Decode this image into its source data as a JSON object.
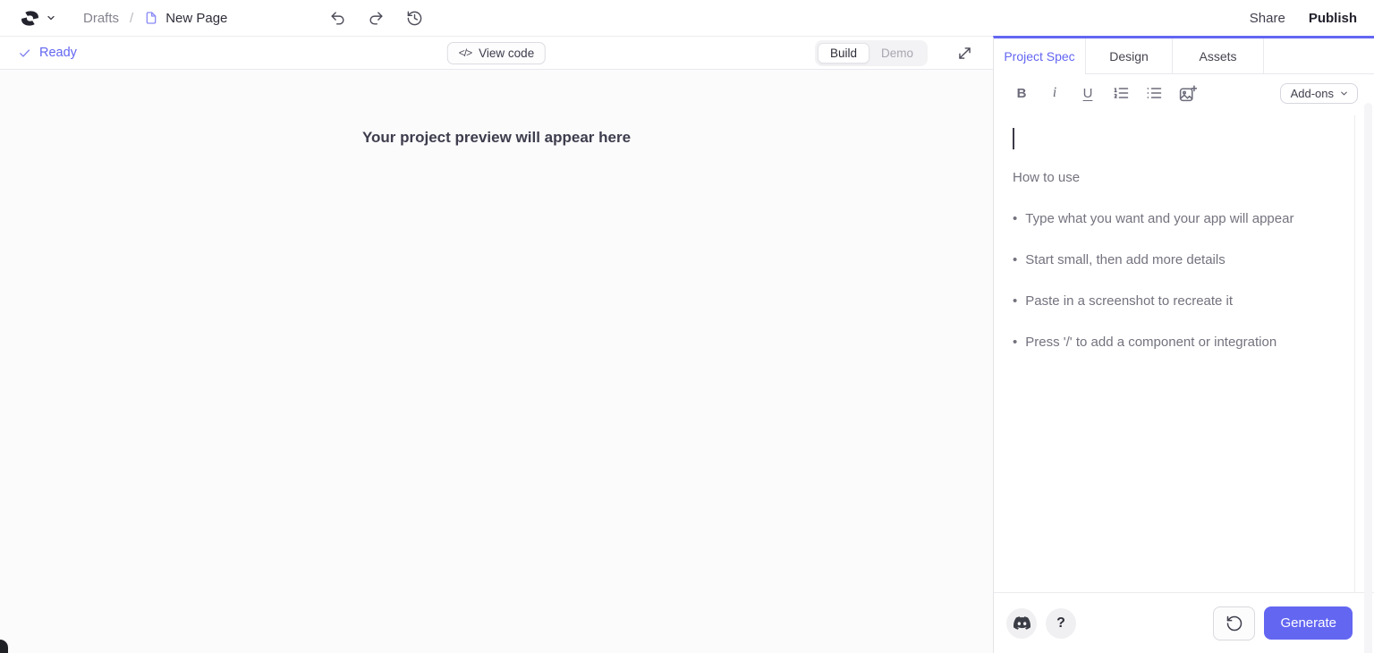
{
  "colors": {
    "accent": "#6366f1",
    "brand_dark": "#23232e"
  },
  "header": {
    "breadcrumb": {
      "folder": "Drafts",
      "separator": "/",
      "page": "New Page"
    },
    "share_label": "Share",
    "publish_label": "Publish"
  },
  "preview": {
    "status_label": "Ready",
    "view_code": {
      "glyph": "</>",
      "label": "View code"
    },
    "mode_toggle": {
      "build": "Build",
      "demo": "Demo",
      "active": "Build"
    },
    "placeholder_message": "Your project preview will appear here"
  },
  "spec_panel": {
    "tabs": [
      {
        "label": "Project Spec",
        "active": true
      },
      {
        "label": "Design",
        "active": false
      },
      {
        "label": "Assets",
        "active": false
      }
    ],
    "toolbar": {
      "bold": "B",
      "italic": "i",
      "underline": "U",
      "addons_label": "Add-ons"
    },
    "editor": {
      "heading": "How to use",
      "bullet_char": "•",
      "bullets": [
        "Type what you want and your app will appear",
        "Start small, then add more details",
        "Paste in a screenshot to recreate it",
        "Press '/' to add a component or integration"
      ]
    },
    "footer": {
      "help_label": "?",
      "generate_label": "Generate"
    }
  }
}
